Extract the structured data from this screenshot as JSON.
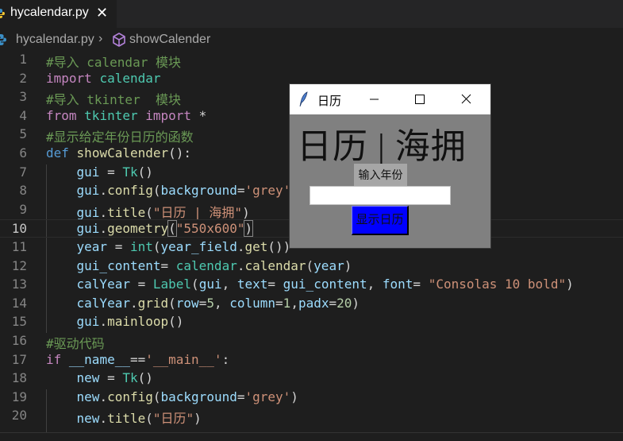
{
  "tabs": [
    {
      "label": "hycalendar.py",
      "icon": "python-file-icon",
      "close_icon": "close-icon",
      "close_glyph": "✕"
    }
  ],
  "breadcrumb": {
    "file": "hycalendar.py",
    "separator": "›",
    "symbol": "showCalender",
    "symbol_icon": "method-cube-icon"
  },
  "editor": {
    "current_line": 10,
    "lines": [
      {
        "n": "1",
        "tokens": [
          {
            "t": "#导入 calendar 模块",
            "c": "c-com"
          }
        ]
      },
      {
        "n": "2",
        "tokens": [
          {
            "t": "import",
            "c": "c-kw"
          },
          {
            "t": " ",
            "c": "c-p"
          },
          {
            "t": "calendar",
            "c": "c-mod"
          }
        ]
      },
      {
        "n": "3",
        "tokens": [
          {
            "t": "#导入 tkinter  模块",
            "c": "c-com"
          }
        ]
      },
      {
        "n": "4",
        "tokens": [
          {
            "t": "from",
            "c": "c-kw"
          },
          {
            "t": " ",
            "c": "c-p"
          },
          {
            "t": "tkinter",
            "c": "c-mod"
          },
          {
            "t": " ",
            "c": "c-p"
          },
          {
            "t": "import",
            "c": "c-kw"
          },
          {
            "t": " *",
            "c": "c-p"
          }
        ]
      },
      {
        "n": "5",
        "tokens": [
          {
            "t": "#显示给定年份日历的函数",
            "c": "c-com"
          }
        ]
      },
      {
        "n": "6",
        "tokens": [
          {
            "t": "def",
            "c": "c-def"
          },
          {
            "t": " ",
            "c": "c-p"
          },
          {
            "t": "showCalender",
            "c": "c-fn"
          },
          {
            "t": "():",
            "c": "c-p"
          }
        ]
      },
      {
        "n": "7",
        "tokens": [
          {
            "t": "    ",
            "c": "c-p"
          },
          {
            "t": "gui",
            "c": "c-var"
          },
          {
            "t": " = ",
            "c": "c-p"
          },
          {
            "t": "Tk",
            "c": "c-cls"
          },
          {
            "t": "()",
            "c": "c-p"
          }
        ]
      },
      {
        "n": "8",
        "tokens": [
          {
            "t": "    ",
            "c": "c-p"
          },
          {
            "t": "gui",
            "c": "c-var"
          },
          {
            "t": ".",
            "c": "c-p"
          },
          {
            "t": "config",
            "c": "c-fn"
          },
          {
            "t": "(",
            "c": "c-p"
          },
          {
            "t": "background",
            "c": "c-var"
          },
          {
            "t": "=",
            "c": "c-p"
          },
          {
            "t": "'grey'",
            "c": "c-str"
          },
          {
            "t": ")",
            "c": "c-p"
          }
        ]
      },
      {
        "n": "9",
        "tokens": [
          {
            "t": "    ",
            "c": "c-p"
          },
          {
            "t": "gui",
            "c": "c-var"
          },
          {
            "t": ".",
            "c": "c-p"
          },
          {
            "t": "title",
            "c": "c-fn"
          },
          {
            "t": "(",
            "c": "c-p"
          },
          {
            "t": "\"日历 | 海拥\"",
            "c": "c-str"
          },
          {
            "t": ")",
            "c": "c-p"
          }
        ]
      },
      {
        "n": "10",
        "tokens": [
          {
            "t": "    ",
            "c": "c-p"
          },
          {
            "t": "gui",
            "c": "c-var"
          },
          {
            "t": ".",
            "c": "c-p"
          },
          {
            "t": "geometry",
            "c": "c-fn"
          },
          {
            "t": "(",
            "c": "c-p bracket-hl"
          },
          {
            "t": "\"550x600\"",
            "c": "c-str"
          },
          {
            "t": ")",
            "c": "c-p bracket-hl"
          }
        ]
      },
      {
        "n": "11",
        "tokens": [
          {
            "t": "    ",
            "c": "c-p"
          },
          {
            "t": "year",
            "c": "c-var"
          },
          {
            "t": " = ",
            "c": "c-p"
          },
          {
            "t": "int",
            "c": "c-cls"
          },
          {
            "t": "(",
            "c": "c-p"
          },
          {
            "t": "year_field",
            "c": "c-var"
          },
          {
            "t": ".",
            "c": "c-p"
          },
          {
            "t": "get",
            "c": "c-fn"
          },
          {
            "t": "())",
            "c": "c-p"
          }
        ]
      },
      {
        "n": "12",
        "tokens": [
          {
            "t": "    ",
            "c": "c-p"
          },
          {
            "t": "gui_content",
            "c": "c-var"
          },
          {
            "t": "= ",
            "c": "c-p"
          },
          {
            "t": "calendar",
            "c": "c-mod"
          },
          {
            "t": ".",
            "c": "c-p"
          },
          {
            "t": "calendar",
            "c": "c-fn"
          },
          {
            "t": "(",
            "c": "c-p"
          },
          {
            "t": "year",
            "c": "c-var"
          },
          {
            "t": ")",
            "c": "c-p"
          }
        ]
      },
      {
        "n": "13",
        "tokens": [
          {
            "t": "    ",
            "c": "c-p"
          },
          {
            "t": "calYear",
            "c": "c-var"
          },
          {
            "t": " = ",
            "c": "c-p"
          },
          {
            "t": "Label",
            "c": "c-cls"
          },
          {
            "t": "(",
            "c": "c-p"
          },
          {
            "t": "gui",
            "c": "c-var"
          },
          {
            "t": ", ",
            "c": "c-p"
          },
          {
            "t": "text",
            "c": "c-var"
          },
          {
            "t": "= ",
            "c": "c-p"
          },
          {
            "t": "gui_content",
            "c": "c-var"
          },
          {
            "t": ", ",
            "c": "c-p"
          },
          {
            "t": "font",
            "c": "c-var"
          },
          {
            "t": "= ",
            "c": "c-p"
          },
          {
            "t": "\"Consolas 10 bold\"",
            "c": "c-str"
          },
          {
            "t": ")",
            "c": "c-p"
          }
        ]
      },
      {
        "n": "14",
        "tokens": [
          {
            "t": "    ",
            "c": "c-p"
          },
          {
            "t": "calYear",
            "c": "c-var"
          },
          {
            "t": ".",
            "c": "c-p"
          },
          {
            "t": "grid",
            "c": "c-fn"
          },
          {
            "t": "(",
            "c": "c-p"
          },
          {
            "t": "row",
            "c": "c-var"
          },
          {
            "t": "=",
            "c": "c-p"
          },
          {
            "t": "5",
            "c": "c-num"
          },
          {
            "t": ", ",
            "c": "c-p"
          },
          {
            "t": "column",
            "c": "c-var"
          },
          {
            "t": "=",
            "c": "c-p"
          },
          {
            "t": "1",
            "c": "c-num"
          },
          {
            "t": ",",
            "c": "c-p"
          },
          {
            "t": "padx",
            "c": "c-var"
          },
          {
            "t": "=",
            "c": "c-p"
          },
          {
            "t": "20",
            "c": "c-num"
          },
          {
            "t": ")",
            "c": "c-p"
          }
        ]
      },
      {
        "n": "15",
        "tokens": [
          {
            "t": "    ",
            "c": "c-p"
          },
          {
            "t": "gui",
            "c": "c-var"
          },
          {
            "t": ".",
            "c": "c-p"
          },
          {
            "t": "mainloop",
            "c": "c-fn"
          },
          {
            "t": "()",
            "c": "c-p"
          }
        ]
      },
      {
        "n": "16",
        "tokens": [
          {
            "t": "#驱动代码",
            "c": "c-com"
          }
        ]
      },
      {
        "n": "17",
        "tokens": [
          {
            "t": "if",
            "c": "c-kw"
          },
          {
            "t": " ",
            "c": "c-p"
          },
          {
            "t": "__name__",
            "c": "c-var"
          },
          {
            "t": "==",
            "c": "c-p"
          },
          {
            "t": "'__main__'",
            "c": "c-str"
          },
          {
            "t": ":",
            "c": "c-p"
          }
        ]
      },
      {
        "n": "18",
        "tokens": [
          {
            "t": "    ",
            "c": "c-p"
          },
          {
            "t": "new",
            "c": "c-var"
          },
          {
            "t": " = ",
            "c": "c-p"
          },
          {
            "t": "Tk",
            "c": "c-cls"
          },
          {
            "t": "()",
            "c": "c-p"
          }
        ]
      },
      {
        "n": "19",
        "tokens": [
          {
            "t": "    ",
            "c": "c-p"
          },
          {
            "t": "new",
            "c": "c-var"
          },
          {
            "t": ".",
            "c": "c-p"
          },
          {
            "t": "config",
            "c": "c-fn"
          },
          {
            "t": "(",
            "c": "c-p"
          },
          {
            "t": "background",
            "c": "c-var"
          },
          {
            "t": "=",
            "c": "c-p"
          },
          {
            "t": "'grey'",
            "c": "c-str"
          },
          {
            "t": ")",
            "c": "c-p"
          }
        ]
      },
      {
        "n": "20",
        "tokens": [
          {
            "t": "    ",
            "c": "c-p"
          },
          {
            "t": "new",
            "c": "c-var"
          },
          {
            "t": ".",
            "c": "c-p"
          },
          {
            "t": "title",
            "c": "c-fn"
          },
          {
            "t": "(",
            "c": "c-p"
          },
          {
            "t": "\"日历\"",
            "c": "c-str"
          },
          {
            "t": ")",
            "c": "c-p"
          }
        ]
      }
    ]
  },
  "tk_window": {
    "title": "日历",
    "app_icon": "tk-feather-icon",
    "heading": "日历 | 海拥",
    "year_label": "输入年份",
    "year_field_value": "",
    "show_button_label": "显示日历",
    "colors": {
      "background": "#808080",
      "button": "#0000ff",
      "label_bg": "#a6a6a6"
    }
  },
  "theme": {
    "editor_bg": "#1e1e1e",
    "tabbar_bg": "#252526"
  }
}
